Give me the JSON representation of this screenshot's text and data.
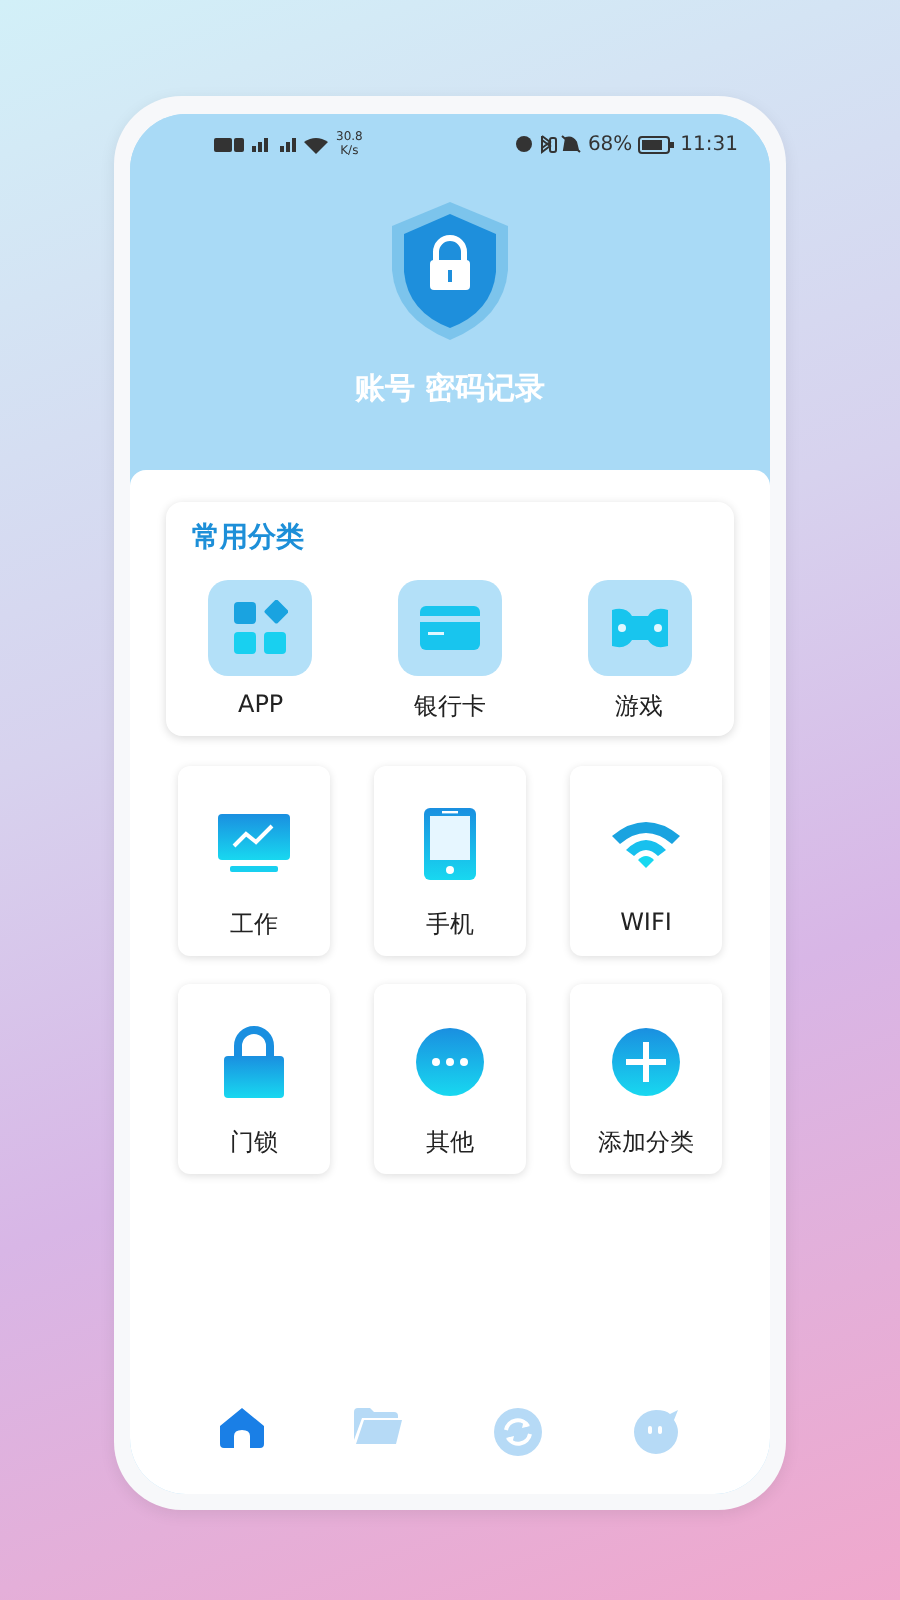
{
  "status_bar": {
    "speed": "30.8",
    "speed_unit": "K/s",
    "battery": "68%",
    "time": "11:31"
  },
  "header": {
    "title": "账号 密码记录"
  },
  "common": {
    "title": "常用分类",
    "items": [
      {
        "label": "APP"
      },
      {
        "label": "银行卡"
      },
      {
        "label": "游戏"
      }
    ]
  },
  "categories": [
    {
      "label": "工作"
    },
    {
      "label": "手机"
    },
    {
      "label": "WIFI"
    },
    {
      "label": "门锁"
    },
    {
      "label": "其他"
    },
    {
      "label": "添加分类"
    }
  ],
  "nav": [
    {
      "selected": true
    },
    {
      "selected": false
    },
    {
      "selected": false
    },
    {
      "selected": false
    }
  ]
}
